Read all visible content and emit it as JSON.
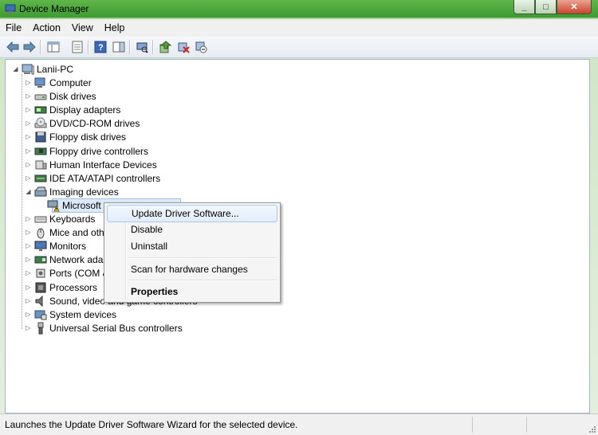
{
  "window": {
    "title": "Device Manager"
  },
  "menu": [
    "File",
    "Action",
    "View",
    "Help"
  ],
  "toolbar": {
    "icons": [
      "back-arrow-icon",
      "forward-arrow-icon",
      "show-hide-console-tree-icon",
      "properties-icon",
      "help-icon",
      "action-pane-icon",
      "scan-hardware-icon",
      "update-driver-icon",
      "disable-device-icon",
      "uninstall-device-icon"
    ]
  },
  "tree": {
    "root": "Lanii-PC",
    "items": [
      {
        "label": "Computer",
        "icon": "computer-icon"
      },
      {
        "label": "Disk drives",
        "icon": "disk-drive-icon"
      },
      {
        "label": "Display adapters",
        "icon": "display-adapter-icon"
      },
      {
        "label": "DVD/CD-ROM drives",
        "icon": "dvd-drive-icon"
      },
      {
        "label": "Floppy disk drives",
        "icon": "floppy-disk-icon"
      },
      {
        "label": "Floppy drive controllers",
        "icon": "floppy-controller-icon"
      },
      {
        "label": "Human Interface Devices",
        "icon": "hid-icon"
      },
      {
        "label": "IDE ATA/ATAPI controllers",
        "icon": "ide-controller-icon"
      },
      {
        "label": "Imaging devices",
        "icon": "imaging-device-icon"
      },
      {
        "label": "Microsoft",
        "icon": "warning-device-icon"
      },
      {
        "label": "Keyboards",
        "icon": "keyboard-icon"
      },
      {
        "label": "Mice and oth",
        "icon": "mouse-icon"
      },
      {
        "label": "Monitors",
        "icon": "monitor-icon"
      },
      {
        "label": "Network adap",
        "icon": "network-adapter-icon"
      },
      {
        "label": "Ports (COM &",
        "icon": "port-icon"
      },
      {
        "label": "Processors",
        "icon": "processor-icon"
      },
      {
        "label": "Sound, video and game controllers",
        "icon": "sound-icon"
      },
      {
        "label": "System devices",
        "icon": "system-device-icon"
      },
      {
        "label": "Universal Serial Bus controllers",
        "icon": "usb-icon"
      }
    ]
  },
  "context_menu": {
    "update": "Update Driver Software...",
    "disable": "Disable",
    "uninstall": "Uninstall",
    "scan": "Scan for hardware changes",
    "properties": "Properties"
  },
  "status": {
    "text": "Launches the Update Driver Software Wizard for the selected device."
  },
  "colors": {
    "titlebar": "#4aa83a",
    "selection": "#dbe9f8",
    "highlight_border": "#a8c8ed"
  }
}
